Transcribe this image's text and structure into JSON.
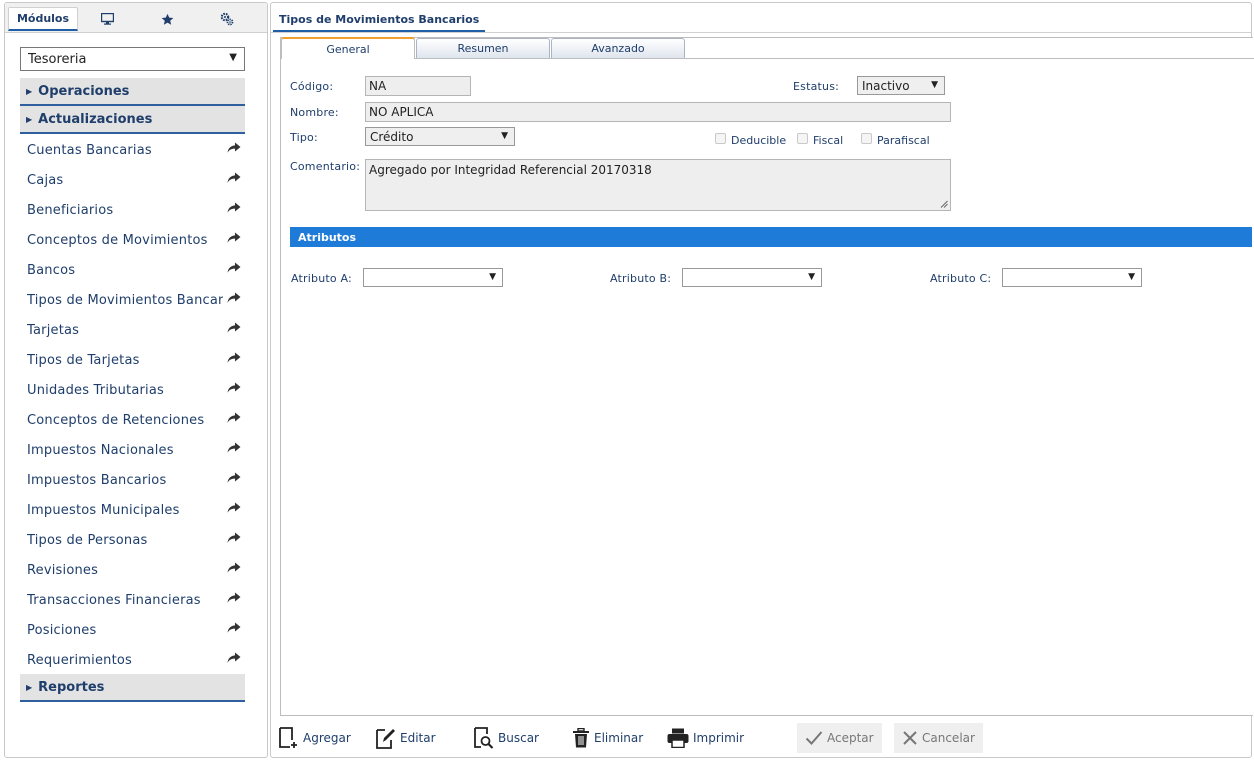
{
  "sidebar": {
    "tabs": {
      "modulos": "Módulos"
    },
    "module_select": "Tesoreria",
    "sections": {
      "operaciones": "Operaciones",
      "actualizaciones": "Actualizaciones",
      "reportes": "Reportes"
    },
    "items": [
      "Cuentas Bancarias",
      "Cajas",
      "Beneficiarios",
      "Conceptos de Movimientos",
      "Bancos",
      "Tipos de Movimientos Bancarios",
      "Tarjetas",
      "Tipos de Tarjetas",
      "Unidades Tributarias",
      "Conceptos de Retenciones",
      "Impuestos Nacionales",
      "Impuestos Bancarios",
      "Impuestos Municipales",
      "Tipos de Personas",
      "Revisiones",
      "Transacciones Financieras",
      "Posiciones",
      "Requerimientos"
    ]
  },
  "main": {
    "title": "Tipos de Movimientos Bancarios",
    "tabs": {
      "general": "General",
      "resumen": "Resumen",
      "avanzado": "Avanzado"
    },
    "form": {
      "codigo_label": "Código:",
      "codigo_value": "NA",
      "estatus_label": "Estatus:",
      "estatus_value": "Inactivo",
      "nombre_label": "Nombre:",
      "nombre_value": "NO APLICA",
      "tipo_label": "Tipo:",
      "tipo_value": "Crédito",
      "deducible_label": "Deducible",
      "fiscal_label": "Fiscal",
      "parafiscal_label": "Parafiscal",
      "comentario_label": "Comentario:",
      "comentario_value": "Agregado por Integridad Referencial 20170318"
    },
    "atributos": {
      "header": "Atributos",
      "a_label": "Atributo A:",
      "b_label": "Atributo B:",
      "c_label": "Atributo C:"
    }
  },
  "toolbar": {
    "agregar": "Agregar",
    "editar": "Editar",
    "buscar": "Buscar",
    "eliminar": "Eliminar",
    "imprimir": "Imprimir",
    "aceptar": "Aceptar",
    "cancelar": "Cancelar"
  },
  "colors": {
    "accent": "#1f7bd8",
    "nav_text": "#1f3e6b",
    "active_tab": "#f0a030"
  }
}
